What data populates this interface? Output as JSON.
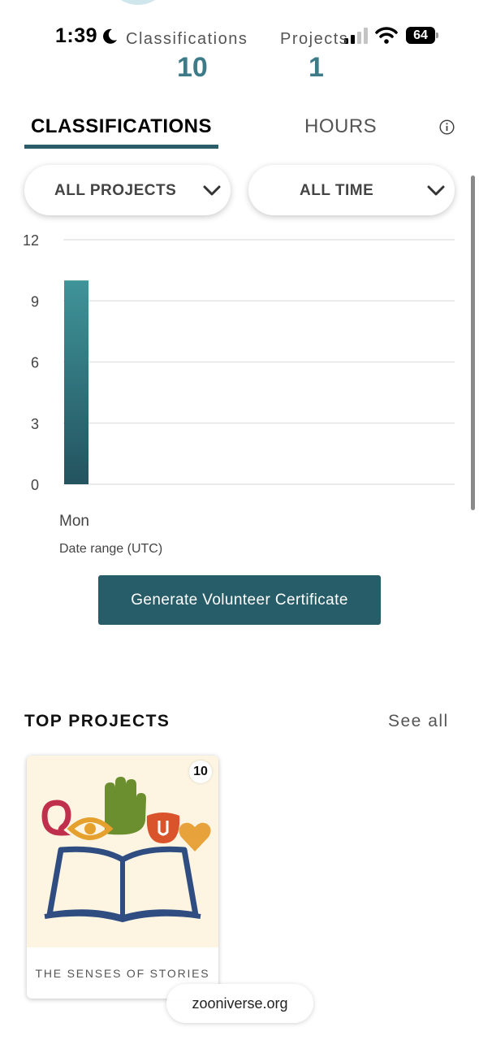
{
  "status_bar": {
    "time": "1:39",
    "battery": "64",
    "icons": [
      "moon-icon",
      "signal-icon",
      "wifi-icon",
      "battery-icon"
    ]
  },
  "stats": {
    "classifications_label": "Classifications",
    "classifications_value": "10",
    "projects_label": "Projects",
    "projects_value": "1"
  },
  "tabs": {
    "classifications": "CLASSIFICATIONS",
    "hours": "HOURS",
    "active": "CLASSIFICATIONS"
  },
  "filters": {
    "project": "ALL PROJECTS",
    "time": "ALL TIME"
  },
  "chart_data": {
    "type": "bar",
    "categories": [
      "Mon"
    ],
    "values": [
      10
    ],
    "title": "",
    "xlabel": "Date range (UTC)",
    "ylabel": "",
    "ylim": [
      0,
      12
    ],
    "yticks": [
      "0",
      "3",
      "6",
      "9",
      "12"
    ],
    "grid": true,
    "colors": {
      "bar_top": "#3f9499",
      "bar_bottom": "#23535f",
      "grid": "#e4e4e4"
    }
  },
  "certificate_button": "Generate Volunteer Certificate",
  "top_projects": {
    "title": "TOP PROJECTS",
    "see_all": "See all",
    "projects": [
      {
        "name": "THE SENSES OF STORIES",
        "count": "10"
      }
    ]
  },
  "browser": {
    "url": "zooniverse.org"
  },
  "colors": {
    "accent": "#275d68",
    "stat_value": "#3d7b88"
  }
}
